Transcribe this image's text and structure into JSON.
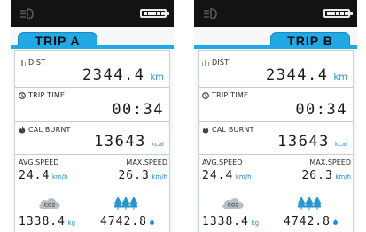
{
  "screens": [
    {
      "tab_label": "TRIP A",
      "dist_label": "DIST",
      "dist_value": "2344.4",
      "dist_unit": "km",
      "trip_time_label": "TRIP TIME",
      "trip_time_value": "00:34",
      "cal_label": "CAL BURNT",
      "cal_value": "13643",
      "cal_unit": "kcal",
      "avg_speed_label": "AVG.SPEED",
      "avg_speed_value": "24.4",
      "avg_speed_unit": "km/h",
      "max_speed_label": "MAX.SPEED",
      "max_speed_value": "26.3",
      "max_speed_unit": "km/h",
      "co2_value": "1338.4",
      "co2_unit": "kg",
      "trees_value": "4742.8"
    },
    {
      "tab_label": "TRIP B",
      "dist_label": "DIST",
      "dist_value": "2344.4",
      "dist_unit": "km",
      "trip_time_label": "TRIP TIME",
      "trip_time_value": "00:34",
      "cal_label": "CAL BURNT",
      "cal_value": "13643",
      "cal_unit": "kcal",
      "avg_speed_label": "AVG.SPEED",
      "avg_speed_value": "24.4",
      "avg_speed_unit": "km/h",
      "max_speed_label": "MAX.SPEED",
      "max_speed_value": "26.3",
      "max_speed_unit": "km/h",
      "co2_value": "1338.4",
      "co2_unit": "kg",
      "trees_value": "4742.8"
    }
  ],
  "co2_icon_text": "CO2",
  "colors": {
    "accent": "#21a8e5",
    "unit_blue": "#1c8fd0",
    "status_bar": "#131313"
  },
  "icons": [
    "headlight-icon",
    "battery-icon",
    "road-icon",
    "clock-icon",
    "flame-icon",
    "co2-cloud-icon",
    "trees-icon",
    "drop-icon"
  ]
}
